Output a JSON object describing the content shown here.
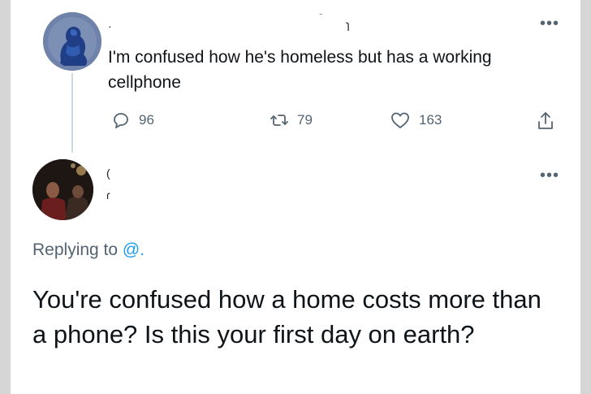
{
  "tweet1": {
    "name_scraps": [
      "·",
      "-",
      "ɿ"
    ],
    "text": "I'm confused how he's homeless but has a working cellphone",
    "more_label": "•••",
    "actions": {
      "replies": "96",
      "retweets": "79",
      "likes": "163"
    }
  },
  "tweet2": {
    "name_scraps": [
      "(",
      "ɾ"
    ],
    "more_label": "•••",
    "replying_prefix": "Replying to",
    "replying_handle": "@.",
    "text": "You're confused how a home costs more than a phone? Is this your first day on earth?"
  },
  "colors": {
    "text_primary": "#0f1419",
    "text_secondary": "#536471",
    "link": "#1d9bf0",
    "thread_line": "#cfd9de"
  },
  "icons": [
    "reply-icon",
    "retweet-icon",
    "like-icon",
    "share-icon",
    "more-icon"
  ]
}
